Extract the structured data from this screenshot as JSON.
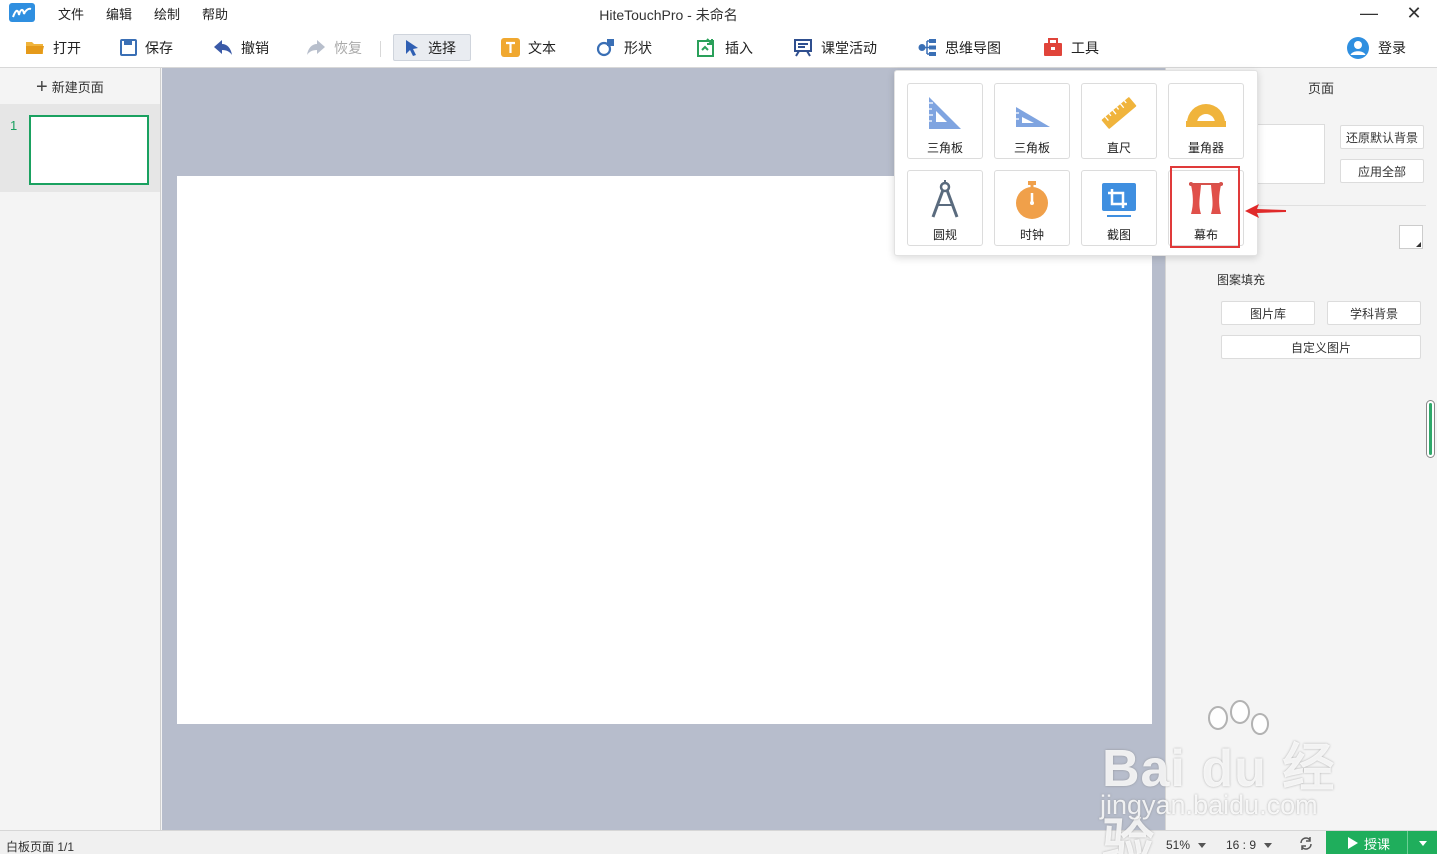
{
  "window": {
    "title": "HiteTouchPro - 未命名",
    "menu": [
      "文件",
      "编辑",
      "绘制",
      "帮助"
    ],
    "minimize": "—",
    "close": "✕"
  },
  "toolbar": {
    "open": "打开",
    "save": "保存",
    "undo": "撤销",
    "redo": "恢复",
    "select": "选择",
    "text": "文本",
    "shape": "形状",
    "insert": "插入",
    "class_activity": "课堂活动",
    "mind_map": "思维导图",
    "tools": "工具",
    "login": "登录"
  },
  "left_panel": {
    "new_page": "新建页面",
    "pages": [
      {
        "number": "1"
      }
    ]
  },
  "right_panel": {
    "title": "页面",
    "restore_default_bg": "还原默认背景",
    "apply_all": "应用全部",
    "fill_label_partial": "充",
    "pattern_fill": "图案填充",
    "image_library": "图片库",
    "subject_background": "学科背景",
    "custom_image": "自定义图片"
  },
  "tool_popup": {
    "items": [
      {
        "label": "三角板",
        "icon": "set-square-45-icon"
      },
      {
        "label": "三角板",
        "icon": "set-square-30-icon"
      },
      {
        "label": "直尺",
        "icon": "ruler-icon"
      },
      {
        "label": "量角器",
        "icon": "protractor-icon"
      },
      {
        "label": "圆规",
        "icon": "compass-icon"
      },
      {
        "label": "时钟",
        "icon": "stopwatch-icon"
      },
      {
        "label": "截图",
        "icon": "screenshot-crop-icon"
      },
      {
        "label": "幕布",
        "icon": "curtain-icon"
      }
    ],
    "highlighted": "幕布"
  },
  "statusbar": {
    "page_info": "白板页面 1/1",
    "zoom": "51%",
    "ratio": "16 : 9",
    "lecture": "授课"
  },
  "watermark": {
    "brand": "Bai du 经验",
    "url": "jingyan.baidu.com"
  },
  "colors": {
    "accent_green": "#1fae5c",
    "canvas_bg": "#b7bdcc",
    "highlight_red": "#e03a3a"
  }
}
